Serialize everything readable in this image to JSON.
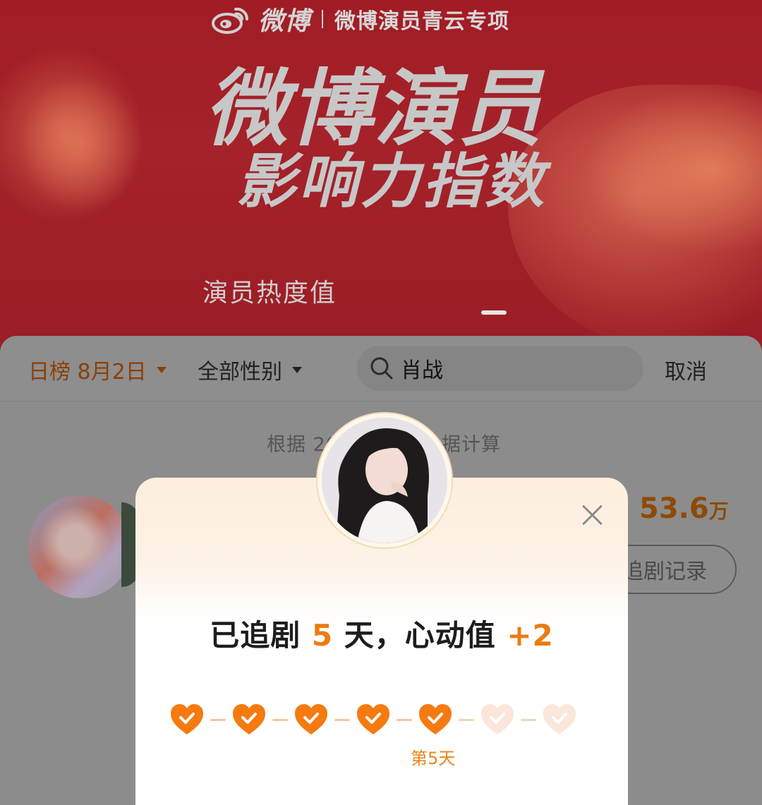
{
  "banner": {
    "brand_name": "微博",
    "brand_sub": "微博演员青云专项",
    "title_line1": "微博演员",
    "title_line2": "影响力指数",
    "active_tab": "演员热度值"
  },
  "filters": {
    "date_label": "日榜 8月2日",
    "gender_label": "全部性别",
    "search_value": "肖战",
    "cancel_label": "取消"
  },
  "list": {
    "note_visible": "根据 20",
    "note_visible_end": "据计算",
    "row": {
      "score": "53.6",
      "score_unit": "万",
      "record_button": "追剧记录"
    }
  },
  "modal": {
    "headline_prefix": "已追剧",
    "days": "5",
    "headline_mid": "天，心动值",
    "bonus": "+2",
    "total_days": 7,
    "completed_days": 5,
    "current_day_label": "第5天"
  },
  "colors": {
    "accent_orange": "#ee7a12",
    "heart_done": "#f57a10",
    "heart_pending": "#fbe6da"
  }
}
